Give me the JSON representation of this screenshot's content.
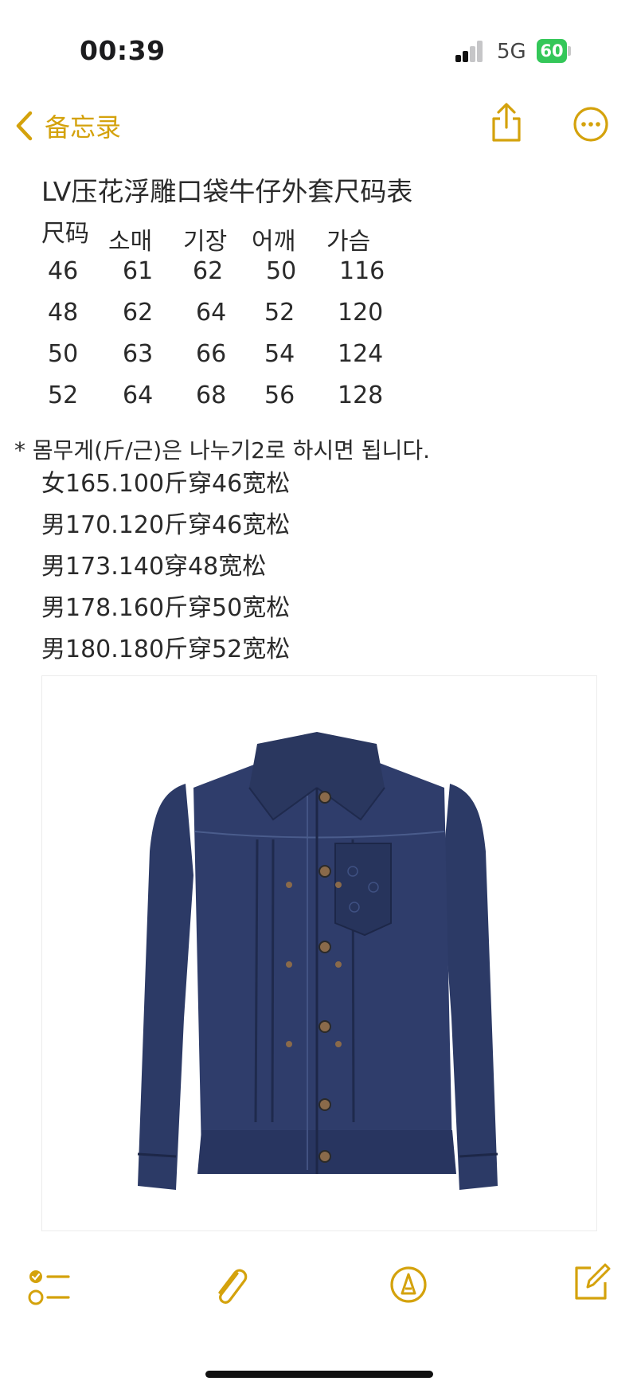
{
  "status_bar": {
    "time": "00:39",
    "network": "5G",
    "battery": "60"
  },
  "nav": {
    "back_label": "备忘录",
    "back_icon": "chevron-left-icon",
    "share_icon": "share-icon",
    "more_icon": "more-icon"
  },
  "note": {
    "title": "LV压花浮雕口袋牛仔外套尺码表",
    "size_table": {
      "headers": [
        "尺码",
        "소매",
        "기장",
        "어깨",
        "가슴"
      ],
      "rows": [
        [
          "46",
          "61",
          "62",
          "50",
          "116"
        ],
        [
          "48",
          "62",
          "64",
          "52",
          "120"
        ],
        [
          "50",
          "63",
          "66",
          "54",
          "124"
        ],
        [
          "52",
          "64",
          "68",
          "56",
          "128"
        ]
      ]
    },
    "weight_note": "* 몸무게(斤/근)은 나누기2로 하시면 됩니다.",
    "fit_lines": [
      "女165.100斤穿46宽松",
      "男170.120斤穿46宽松",
      "男173.140穿48宽松",
      "男178.160斤穿50宽松",
      "男180.180斤穿52宽松"
    ],
    "image_subject": "navy denim jacket with embossed pocket"
  },
  "toolbar": {
    "checklist_icon": "checklist-icon",
    "attachment_icon": "paperclip-icon",
    "markup_icon": "markup-pen-icon",
    "compose_icon": "compose-icon"
  },
  "colors": {
    "accent": "#D4A20C",
    "text": "#2A2A2A",
    "battery": "#34C759",
    "denim": "#2C3A66"
  }
}
